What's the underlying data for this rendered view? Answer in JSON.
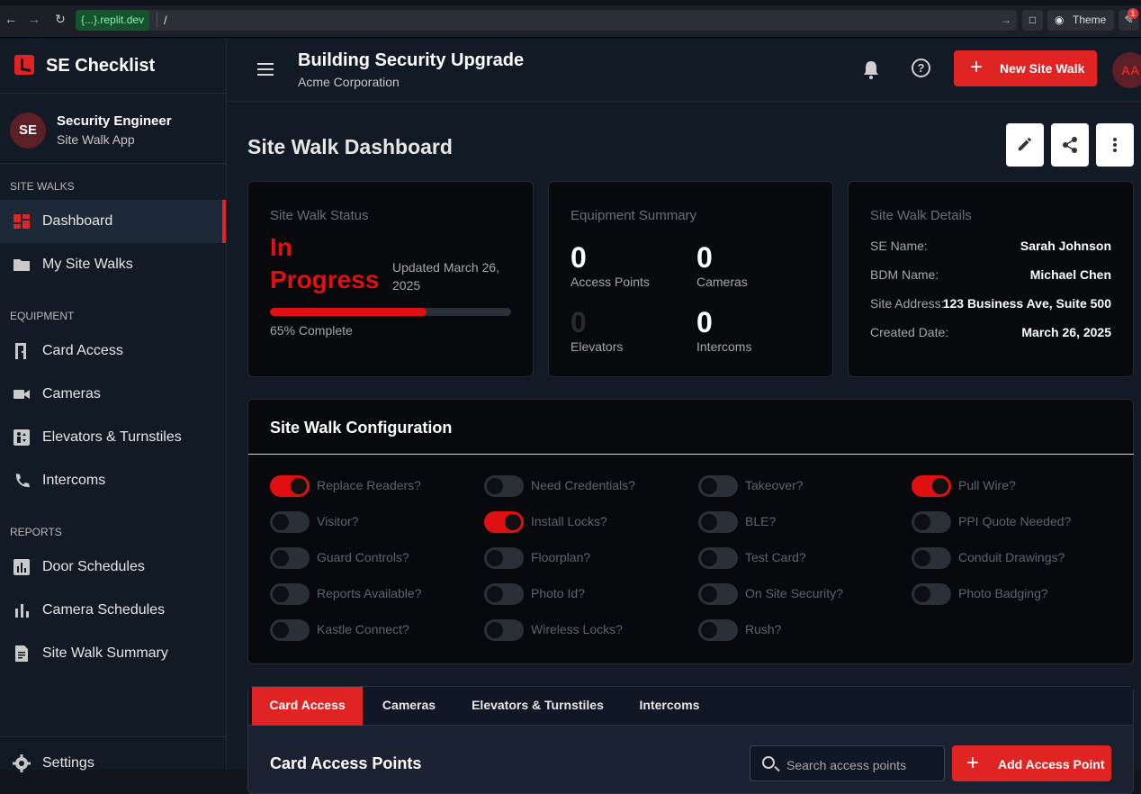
{
  "browser": {
    "host": "{...}.replit.dev",
    "path": "/",
    "theme_label": "Theme",
    "notif_count": "1"
  },
  "sidebar": {
    "brand": "SE Checklist",
    "user_initials": "SE",
    "user_name": "Security Engineer",
    "user_sub": "Site Walk App",
    "sections": {
      "site_walks": "SITE WALKS",
      "equipment": "EQUIPMENT",
      "reports": "REPORTS"
    },
    "items": [
      {
        "label": "Dashboard",
        "icon": "dashboard-icon"
      },
      {
        "label": "My Site Walks",
        "icon": "folder-icon"
      },
      {
        "label": "Card Access",
        "icon": "door-icon"
      },
      {
        "label": "Cameras",
        "icon": "videocam-icon"
      },
      {
        "label": "Elevators & Turnstiles",
        "icon": "elevator-icon"
      },
      {
        "label": "Intercoms",
        "icon": "phone-icon"
      },
      {
        "label": "Door Schedules",
        "icon": "bar-chart-icon"
      },
      {
        "label": "Camera Schedules",
        "icon": "bar-chart-icon"
      },
      {
        "label": "Site Walk Summary",
        "icon": "summary-icon"
      },
      {
        "label": "Settings",
        "icon": "gear-icon"
      }
    ]
  },
  "header": {
    "title": "Building Security Upgrade",
    "subtitle": "Acme Corporation",
    "new_walk_label": "New Site Walk",
    "avatar_initials": "AA"
  },
  "dashboard": {
    "title": "Site Walk Dashboard",
    "status": {
      "label": "Site Walk Status",
      "value": "In Progress",
      "updated": "Updated March 26, 2025",
      "progress": 0.65,
      "progress_text": "65% Complete"
    },
    "equipment": {
      "label": "Equipment Summary",
      "items": [
        {
          "value": "0",
          "label": "Access Points"
        },
        {
          "value": "0",
          "label": "Cameras"
        },
        {
          "value": "0",
          "label": "Elevators"
        },
        {
          "value": "0",
          "label": "Intercoms"
        }
      ]
    },
    "details": {
      "label": "Site Walk Details",
      "rows": [
        {
          "label": "SE Name:",
          "value": "Sarah Johnson"
        },
        {
          "label": "BDM Name:",
          "value": "Michael Chen"
        },
        {
          "label": "Site Address:",
          "value": "123 Business Ave, Suite 500"
        },
        {
          "label": "Created Date:",
          "value": "March 26, 2025"
        }
      ]
    }
  },
  "config": {
    "title": "Site Walk Configuration",
    "toggles": [
      {
        "label": "Replace Readers?",
        "on": true
      },
      {
        "label": "Need Credentials?",
        "on": false
      },
      {
        "label": "Takeover?",
        "on": false
      },
      {
        "label": "Pull Wire?",
        "on": true
      },
      {
        "label": "Visitor?",
        "on": false
      },
      {
        "label": "Install Locks?",
        "on": true
      },
      {
        "label": "BLE?",
        "on": false
      },
      {
        "label": "PPI Quote Needed?",
        "on": false
      },
      {
        "label": "Guard Controls?",
        "on": false
      },
      {
        "label": "Floorplan?",
        "on": false
      },
      {
        "label": "Test Card?",
        "on": false
      },
      {
        "label": "Conduit Drawings?",
        "on": false
      },
      {
        "label": "Reports Available?",
        "on": false
      },
      {
        "label": "Photo Id?",
        "on": false
      },
      {
        "label": "On Site Security?",
        "on": false
      },
      {
        "label": "Photo Badging?",
        "on": false
      },
      {
        "label": "Kastle Connect?",
        "on": false
      },
      {
        "label": "Wireless Locks?",
        "on": false
      },
      {
        "label": "Rush?",
        "on": false
      }
    ]
  },
  "tabs": {
    "items": [
      "Card Access",
      "Cameras",
      "Elevators & Turnstiles",
      "Intercoms"
    ],
    "active": 0
  },
  "access_points": {
    "title": "Card Access Points",
    "search_placeholder": "Search access points",
    "add_label": "Add Access Point"
  },
  "colors": {
    "accent": "#e02424",
    "status_red": "#e01010",
    "sidebar_bg": "#121a26"
  }
}
